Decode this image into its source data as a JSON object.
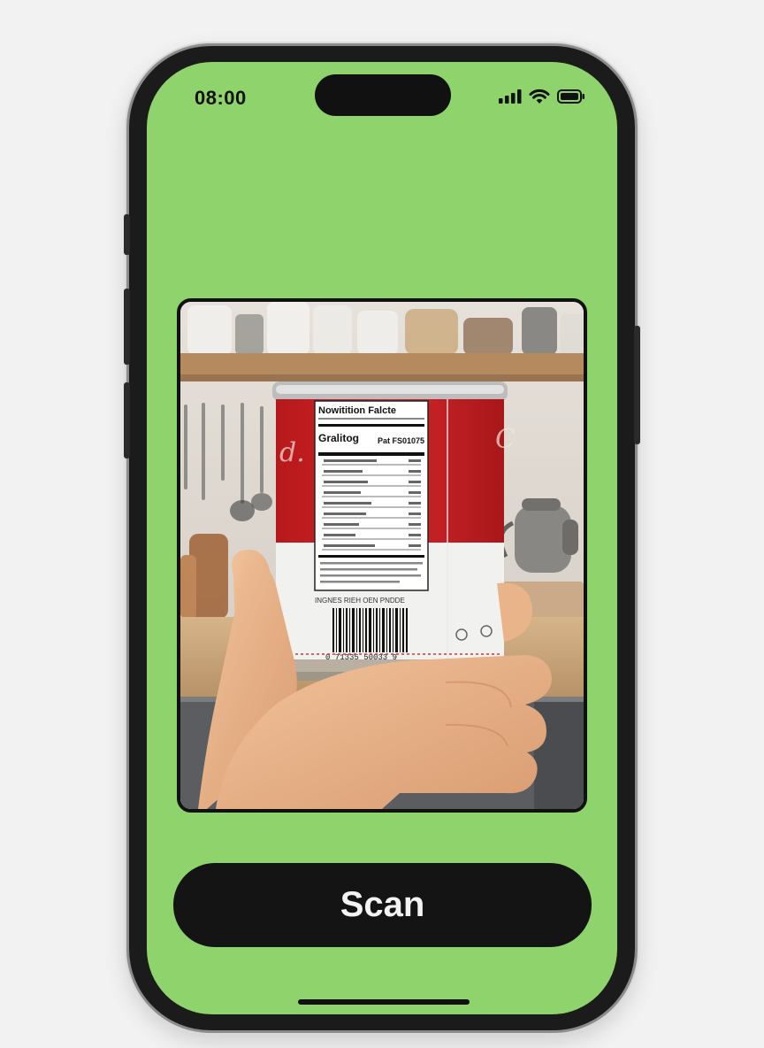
{
  "status_bar": {
    "time": "08:00",
    "icons": [
      "cellular-signal-icon",
      "wifi-icon",
      "battery-icon"
    ]
  },
  "camera_preview": {
    "subject": "hand holding a can showing its nutrition label and barcode",
    "label_title": "Nowitition Falcte",
    "label_subtitle": "Gralitog",
    "label_right": "Pat FS01075",
    "barcode_number": "0 71335 50033 9",
    "bottom_text": "INGNES RIEH OEN PNDDE"
  },
  "scan_button": {
    "label": "Scan"
  },
  "colors": {
    "screen_background": "#8ed36c",
    "button_background": "#141414",
    "button_text": "#f3f3f3",
    "frame": "#1b1b1b"
  }
}
